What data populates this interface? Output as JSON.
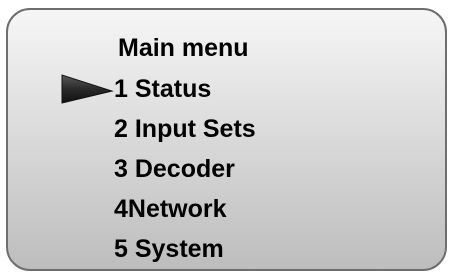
{
  "menu": {
    "title": "Main menu",
    "items": [
      {
        "label": "1 Status",
        "selected": true
      },
      {
        "label": "2 Input Sets"
      },
      {
        "label": "3 Decoder"
      },
      {
        "label": "4Network"
      },
      {
        "label": "5 System"
      }
    ]
  },
  "colors": {
    "panel_top": "#f6f6f6",
    "panel_bottom": "#bdbdbd",
    "border": "#6e6e6e",
    "pointer": "#2a2a2a",
    "text": "#000000"
  },
  "icons": {
    "selection": "triangle-pointer-icon"
  }
}
